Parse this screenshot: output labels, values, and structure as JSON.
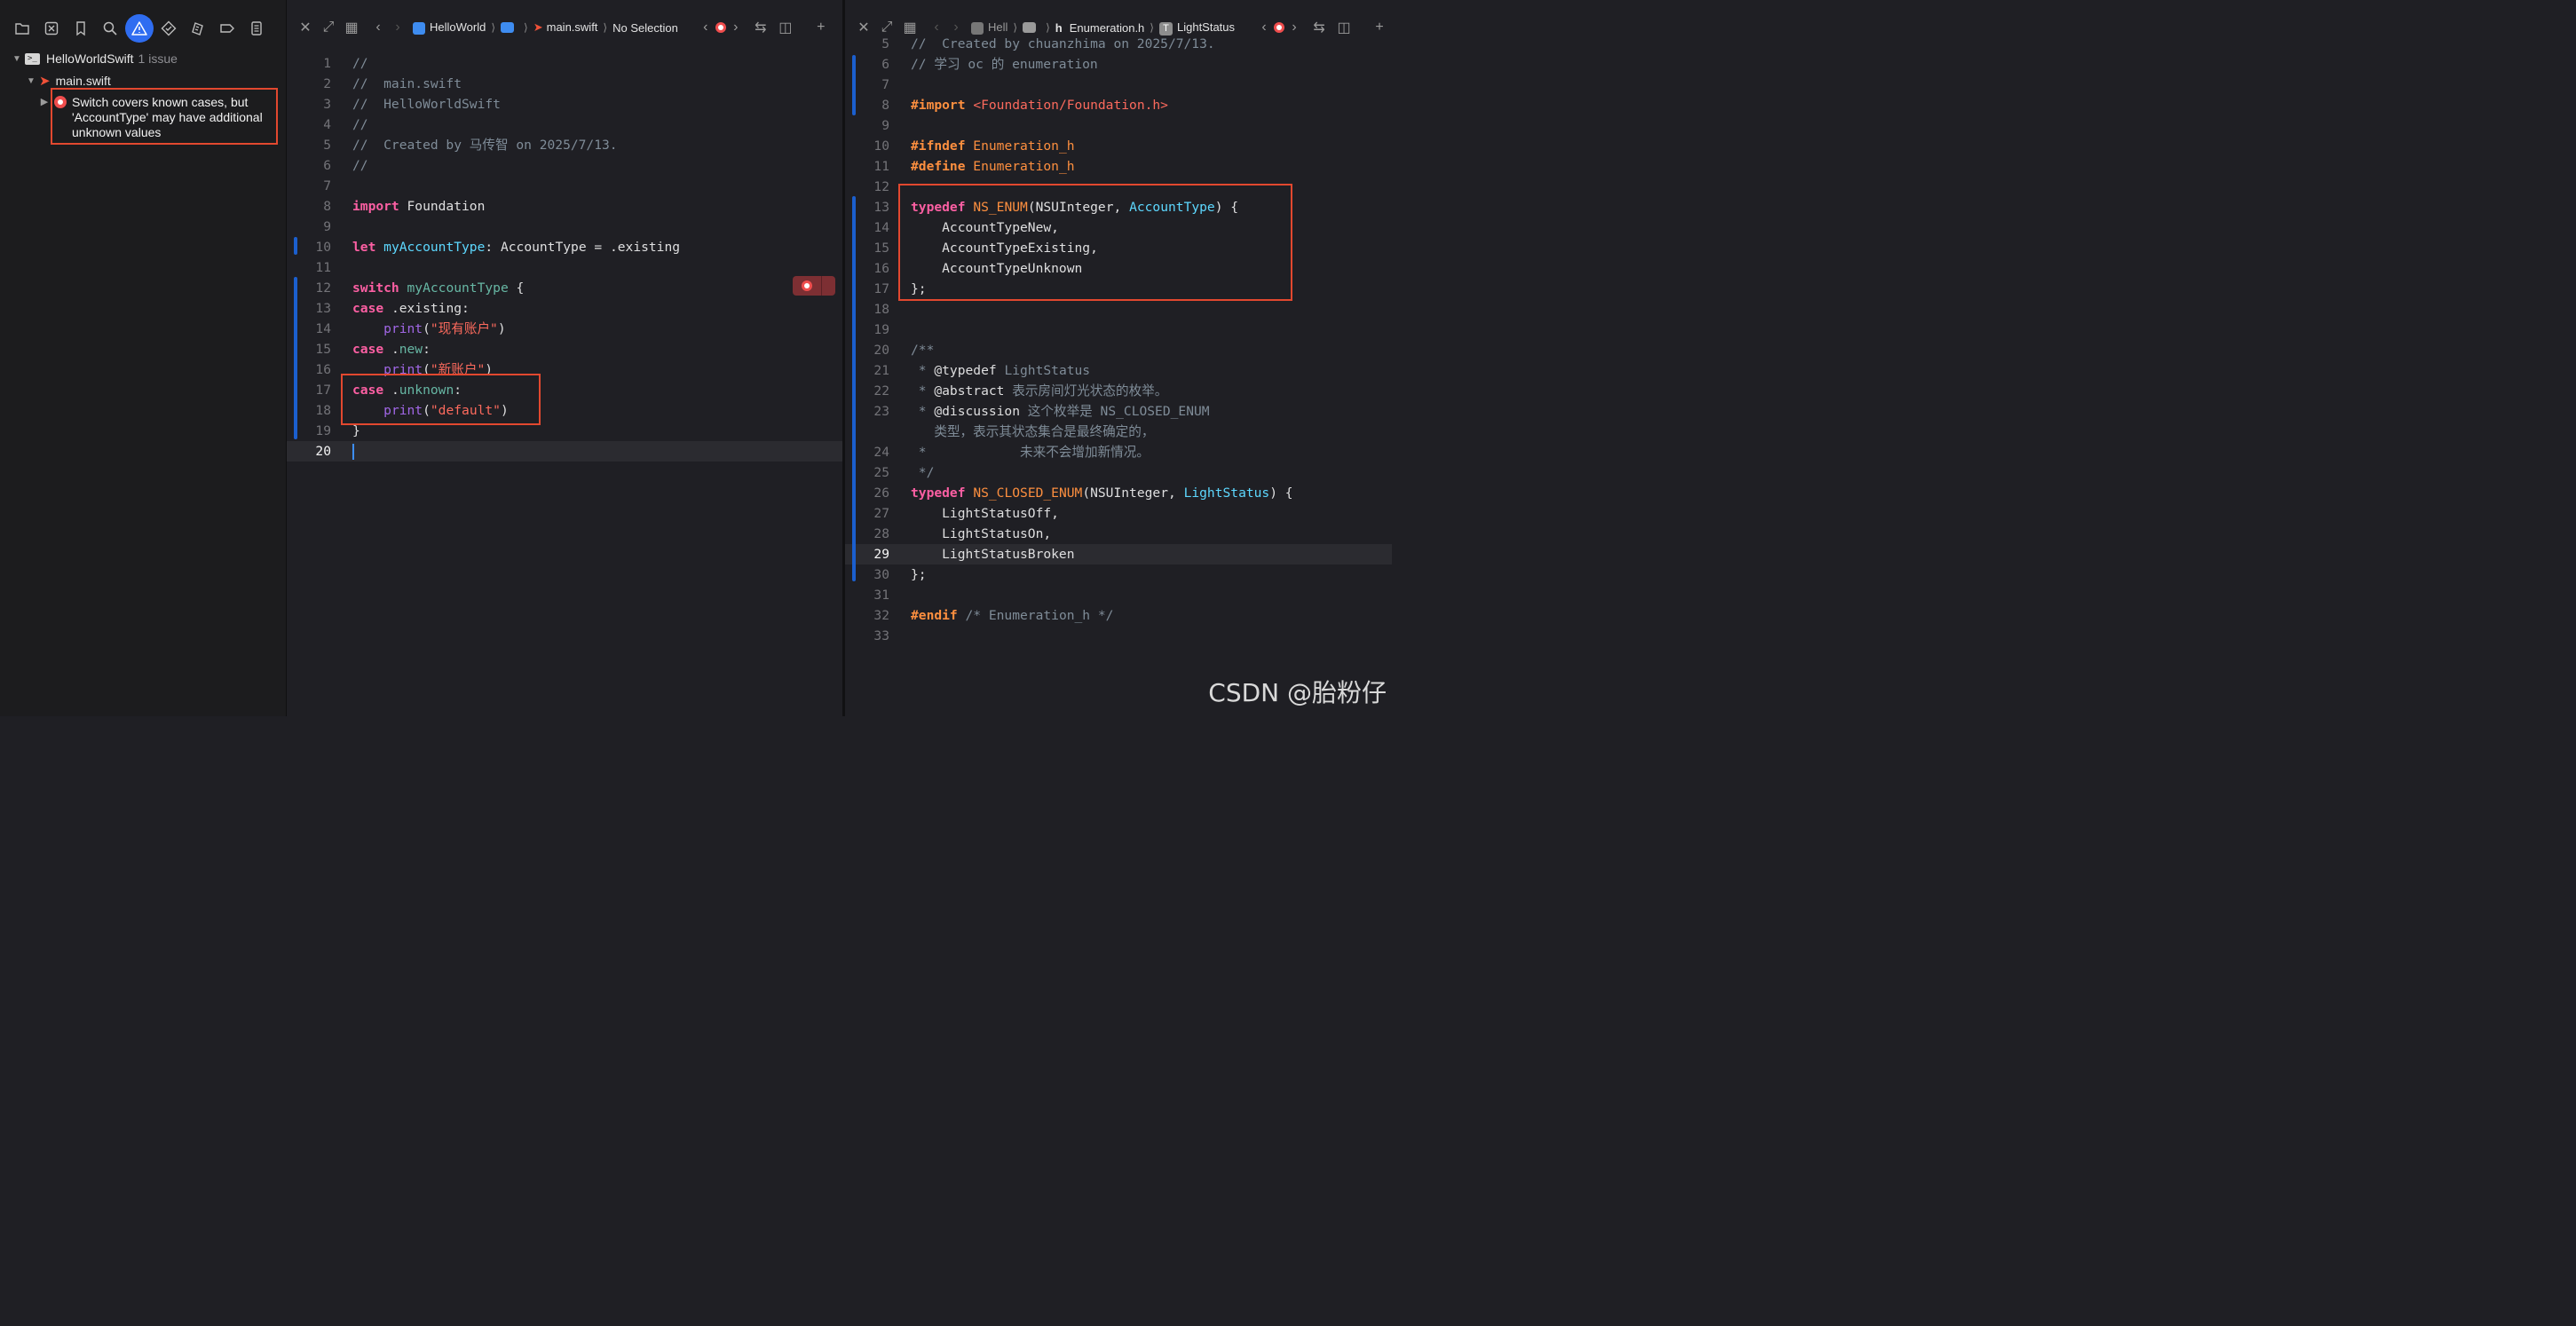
{
  "navigator": {
    "project_name": "HelloWorldSwift",
    "issue_count": "1 issue",
    "file_name": "main.swift",
    "issue_message": "Switch covers known cases, but 'AccountType' may have additional unknown values",
    "toolbar_icons": [
      "folder-icon",
      "source-control-icon",
      "bookmark-icon",
      "search-icon",
      "warning-icon",
      "test-icon",
      "debug-icon",
      "breakpoint-icon",
      "report-icon"
    ]
  },
  "swift_pane": {
    "breadcrumb": {
      "project": "HelloWorld",
      "file": "main.swift",
      "selection": "No Selection"
    },
    "lines": [
      [
        {
          "t": "//",
          "c": "cm"
        }
      ],
      [
        {
          "t": "//  main.swift",
          "c": "cm"
        }
      ],
      [
        {
          "t": "//  HelloWorldSwift",
          "c": "cm"
        }
      ],
      [
        {
          "t": "//",
          "c": "cm"
        }
      ],
      [
        {
          "t": "//  Created by 马传智 on 2025/7/13.",
          "c": "cm"
        }
      ],
      [
        {
          "t": "//",
          "c": "cm"
        }
      ],
      [],
      [
        {
          "t": "import",
          "c": "kw"
        },
        {
          "t": " Foundation",
          "c": "pl"
        }
      ],
      [],
      [
        {
          "t": "let",
          "c": "kw"
        },
        {
          "t": " ",
          "c": "pl"
        },
        {
          "t": "myAccountType",
          "c": "ty"
        },
        {
          "t": ": AccountType = .existing",
          "c": "pl"
        }
      ],
      [],
      [
        {
          "t": "switch",
          "c": "kw"
        },
        {
          "t": " ",
          "c": "pl"
        },
        {
          "t": "myAccountType",
          "c": "uv"
        },
        {
          "t": " {",
          "c": "pl"
        }
      ],
      [
        {
          "t": "case",
          "c": "kw"
        },
        {
          "t": " .existing:",
          "c": "pl"
        }
      ],
      [
        {
          "t": "    ",
          "c": "pl"
        },
        {
          "t": "print",
          "c": "fn"
        },
        {
          "t": "(",
          "c": "pl"
        },
        {
          "t": "\"现有账户\"",
          "c": "str"
        },
        {
          "t": ")",
          "c": "pl"
        }
      ],
      [
        {
          "t": "case",
          "c": "kw"
        },
        {
          "t": " .",
          "c": "pl"
        },
        {
          "t": "new",
          "c": "uv"
        },
        {
          "t": ":",
          "c": "pl"
        }
      ],
      [
        {
          "t": "    ",
          "c": "pl"
        },
        {
          "t": "print",
          "c": "fn"
        },
        {
          "t": "(",
          "c": "pl"
        },
        {
          "t": "\"新账户\"",
          "c": "str"
        },
        {
          "t": ")",
          "c": "pl"
        }
      ],
      [
        {
          "t": "case",
          "c": "kw"
        },
        {
          "t": " .",
          "c": "pl"
        },
        {
          "t": "unknown",
          "c": "uv"
        },
        {
          "t": ":",
          "c": "pl"
        }
      ],
      [
        {
          "t": "    ",
          "c": "pl"
        },
        {
          "t": "print",
          "c": "fn"
        },
        {
          "t": "(",
          "c": "pl"
        },
        {
          "t": "\"default\"",
          "c": "str"
        },
        {
          "t": ")",
          "c": "pl"
        }
      ],
      [
        {
          "t": "}",
          "c": "pl"
        }
      ],
      []
    ],
    "current_line": 20
  },
  "objc_pane": {
    "breadcrumb": {
      "project": "Hell",
      "file": "Enumeration.h",
      "symbol": "LightStatus"
    },
    "lines": [
      {
        "n": "5",
        "s": [
          {
            "t": "//  Created by chuanzhima on 2025/7/13.",
            "c": "cm"
          }
        ]
      },
      {
        "n": "6",
        "s": [
          {
            "t": "// 学习 oc 的 enumeration",
            "c": "cm"
          }
        ]
      },
      {
        "n": "7",
        "s": []
      },
      {
        "n": "8",
        "s": [
          {
            "t": "#import",
            "c": "pp"
          },
          {
            "t": " ",
            "c": "pl"
          },
          {
            "t": "<Foundation/Foundation.h>",
            "c": "str"
          }
        ]
      },
      {
        "n": "9",
        "s": []
      },
      {
        "n": "10",
        "s": [
          {
            "t": "#ifndef",
            "c": "pp"
          },
          {
            "t": " Enumeration_h",
            "c": "mc"
          }
        ]
      },
      {
        "n": "11",
        "s": [
          {
            "t": "#define",
            "c": "pp"
          },
          {
            "t": " Enumeration_h",
            "c": "mc"
          }
        ]
      },
      {
        "n": "12",
        "s": []
      },
      {
        "n": "13",
        "s": [
          {
            "t": "typedef",
            "c": "kw"
          },
          {
            "t": " ",
            "c": "pl"
          },
          {
            "t": "NS_ENUM",
            "c": "mc"
          },
          {
            "t": "(NSUInteger, ",
            "c": "pl"
          },
          {
            "t": "AccountType",
            "c": "ty"
          },
          {
            "t": ") {",
            "c": "pl"
          }
        ]
      },
      {
        "n": "14",
        "s": [
          {
            "t": "    AccountTypeNew,",
            "c": "pl"
          }
        ]
      },
      {
        "n": "15",
        "s": [
          {
            "t": "    AccountTypeExisting,",
            "c": "pl"
          }
        ]
      },
      {
        "n": "16",
        "s": [
          {
            "t": "    AccountTypeUnknown",
            "c": "pl"
          }
        ]
      },
      {
        "n": "17",
        "s": [
          {
            "t": "};",
            "c": "pl"
          }
        ]
      },
      {
        "n": "18",
        "s": []
      },
      {
        "n": "19",
        "s": []
      },
      {
        "n": "20",
        "s": [
          {
            "t": "/**",
            "c": "cm"
          }
        ]
      },
      {
        "n": "21",
        "s": [
          {
            "t": " * ",
            "c": "cm"
          },
          {
            "t": "@typedef",
            "c": "pl"
          },
          {
            "t": " LightStatus",
            "c": "cm"
          }
        ]
      },
      {
        "n": "22",
        "s": [
          {
            "t": " * ",
            "c": "cm"
          },
          {
            "t": "@abstract",
            "c": "pl"
          },
          {
            "t": " 表示房间灯光状态的枚举。",
            "c": "cm"
          }
        ]
      },
      {
        "n": "23",
        "s": [
          {
            "t": " * ",
            "c": "cm"
          },
          {
            "t": "@discussion",
            "c": "pl"
          },
          {
            "t": " 这个枚举是 NS_CLOSED_ENUM",
            "c": "cm"
          }
        ]
      },
      {
        "n": "",
        "s": [
          {
            "t": "   类型，表示其状态集合是最终确定的，",
            "c": "cm"
          }
        ]
      },
      {
        "n": "24",
        "s": [
          {
            "t": " *            未来不会增加新情况。",
            "c": "cm"
          }
        ]
      },
      {
        "n": "25",
        "s": [
          {
            "t": " */",
            "c": "cm"
          }
        ]
      },
      {
        "n": "26",
        "s": [
          {
            "t": "typedef",
            "c": "kw"
          },
          {
            "t": " ",
            "c": "pl"
          },
          {
            "t": "NS_CLOSED_ENUM",
            "c": "mc"
          },
          {
            "t": "(NSUInteger, ",
            "c": "pl"
          },
          {
            "t": "LightStatus",
            "c": "ty"
          },
          {
            "t": ") {",
            "c": "pl"
          }
        ]
      },
      {
        "n": "27",
        "s": [
          {
            "t": "    LightStatusOff,",
            "c": "pl"
          }
        ]
      },
      {
        "n": "28",
        "s": [
          {
            "t": "    LightStatusOn,",
            "c": "pl"
          }
        ]
      },
      {
        "n": "29",
        "s": [
          {
            "t": "    LightStatusBroken",
            "c": "pl"
          }
        ],
        "current": true
      },
      {
        "n": "30",
        "s": [
          {
            "t": "};",
            "c": "pl"
          }
        ]
      },
      {
        "n": "31",
        "s": []
      },
      {
        "n": "32",
        "s": [
          {
            "t": "#endif",
            "c": "pp"
          },
          {
            "t": " /* Enumeration_h */",
            "c": "cm"
          }
        ]
      },
      {
        "n": "33",
        "s": []
      }
    ]
  },
  "watermark": "CSDN @胎粉仔",
  "colors": {
    "accent": "#2f6df1",
    "highlight_box": "#e2482f",
    "error": "#ef4d4d"
  }
}
